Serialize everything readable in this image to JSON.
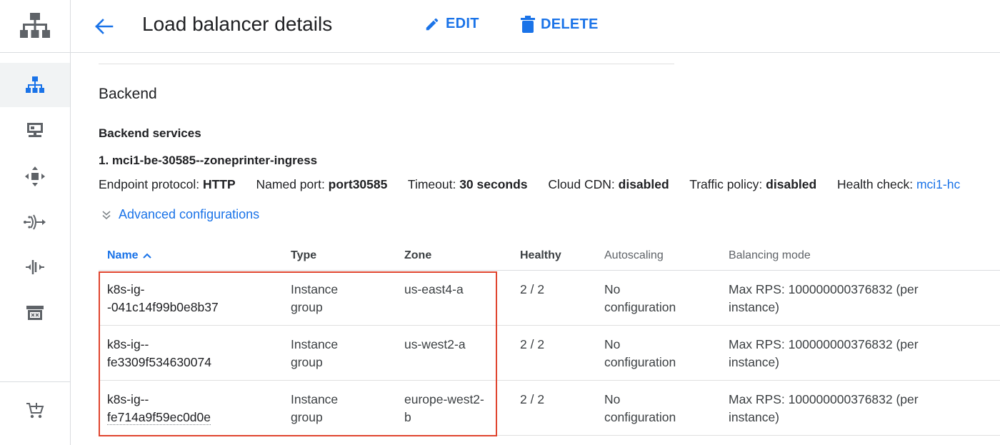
{
  "header": {
    "title": "Load balancer details",
    "edit_label": "EDIT",
    "delete_label": "DELETE"
  },
  "rail": {
    "icons": [
      "network-services-logo-icon",
      "load-balancing-icon",
      "cloud-dns-icon",
      "cloud-cdn-icon",
      "cloud-nat-icon",
      "traffic-director-icon",
      "service-directory-icon",
      "marketplace-icon"
    ],
    "active": "load-balancing-icon"
  },
  "backend": {
    "section_title": "Backend",
    "subheading": "Backend services",
    "service_name": "1. mci1-be-30585--zoneprinter-ingress",
    "props": {
      "endpoint_protocol_label": "Endpoint protocol: ",
      "endpoint_protocol": "HTTP",
      "named_port_label": "Named port: ",
      "named_port": "port30585",
      "timeout_label": "Timeout: ",
      "timeout": "30 seconds",
      "cdn_label": "Cloud CDN: ",
      "cdn": "disabled",
      "traffic_label": "Traffic policy: ",
      "traffic": "disabled",
      "health_label": "Health check: ",
      "health": "mci1-hc"
    },
    "advanced_label": "Advanced configurations"
  },
  "table": {
    "headers": {
      "name": "Name",
      "type": "Type",
      "zone": "Zone",
      "healthy": "Healthy",
      "autoscaling": "Autoscaling",
      "balancing_mode": "Balancing mode"
    },
    "rows": [
      {
        "name_line1": "k8s-ig-",
        "name_line2": "-041c14f99b0e8b37",
        "type_line1": "Instance",
        "type_line2": "group",
        "zone_line1": "us-east4-a",
        "zone_line2": "",
        "healthy": "2 / 2",
        "autoscaling_line1": "No",
        "autoscaling_line2": "configuration",
        "mode_line1": "Max RPS: 100000000376832 (per",
        "mode_line2": "instance)"
      },
      {
        "name_line1": "k8s-ig--",
        "name_line2": "fe3309f534630074",
        "type_line1": "Instance",
        "type_line2": "group",
        "zone_line1": "us-west2-a",
        "zone_line2": "",
        "healthy": "2 / 2",
        "autoscaling_line1": "No",
        "autoscaling_line2": "configuration",
        "mode_line1": "Max RPS: 100000000376832 (per",
        "mode_line2": "instance)"
      },
      {
        "name_line1": "k8s-ig--",
        "name_line2": "fe714a9f59ec0d0e",
        "type_line1": "Instance",
        "type_line2": "group",
        "zone_line1": "europe-west2-",
        "zone_line2": "b",
        "healthy": "2 / 2",
        "autoscaling_line1": "No",
        "autoscaling_line2": "configuration",
        "mode_line1": "Max RPS: 100000000376832 (per",
        "mode_line2": "instance)"
      }
    ]
  },
  "colors": {
    "accent": "#1a73e8",
    "highlight_border": "#e0452f",
    "icon_gray": "#5f6368"
  }
}
